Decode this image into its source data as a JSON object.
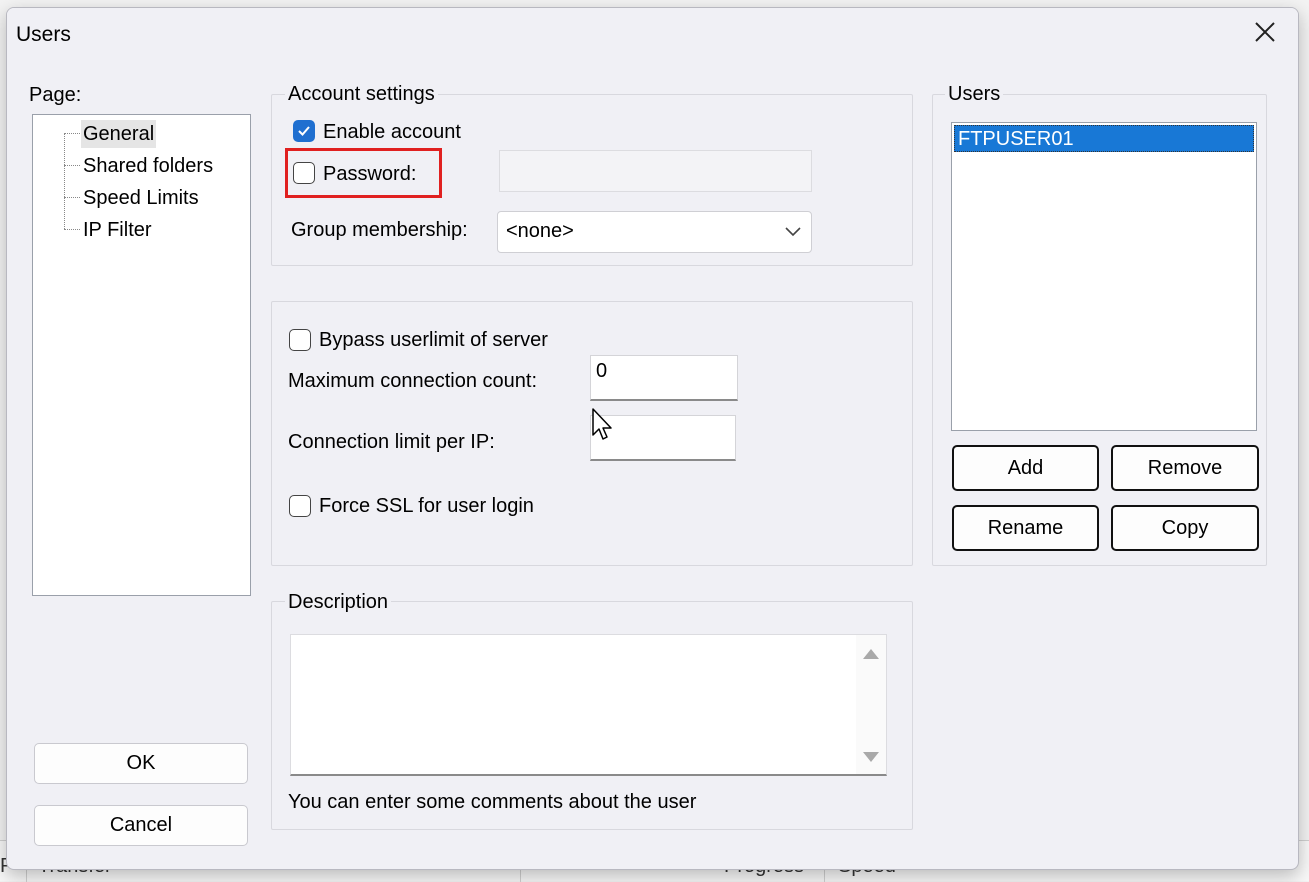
{
  "background": {
    "left_text": "P",
    "transfer_text": "Transfer",
    "progress_text": "Progress",
    "speed_text": "Speed"
  },
  "dialog": {
    "title": "Users",
    "close_icon": "close-icon"
  },
  "page": {
    "label": "Page:",
    "items": [
      {
        "label": "General",
        "selected": true
      },
      {
        "label": "Shared folders",
        "selected": false
      },
      {
        "label": "Speed Limits",
        "selected": false
      },
      {
        "label": "IP Filter",
        "selected": false
      }
    ]
  },
  "account": {
    "legend": "Account settings",
    "enable_label": "Enable account",
    "enable_checked": true,
    "password_label": "Password:",
    "password_checked": false,
    "password_value": "",
    "group_label": "Group membership:",
    "group_value": "<none>"
  },
  "limits": {
    "bypass_label": "Bypass userlimit of server",
    "bypass_checked": false,
    "max_conn_label": "Maximum connection count:",
    "max_conn_value": "0",
    "conn_per_ip_label": "Connection limit per IP:",
    "conn_per_ip_value": "",
    "force_ssl_label": "Force SSL for user login",
    "force_ssl_checked": false
  },
  "description": {
    "legend": "Description",
    "value": "",
    "hint": "You can enter some comments about the user"
  },
  "users": {
    "legend": "Users",
    "items": [
      "FTPUSER01"
    ],
    "selected": "FTPUSER01",
    "add_label": "Add",
    "remove_label": "Remove",
    "rename_label": "Rename",
    "copy_label": "Copy"
  },
  "footer": {
    "ok_label": "OK",
    "cancel_label": "Cancel"
  },
  "colors": {
    "accent": "#1878d6",
    "highlight": "#e02020"
  }
}
